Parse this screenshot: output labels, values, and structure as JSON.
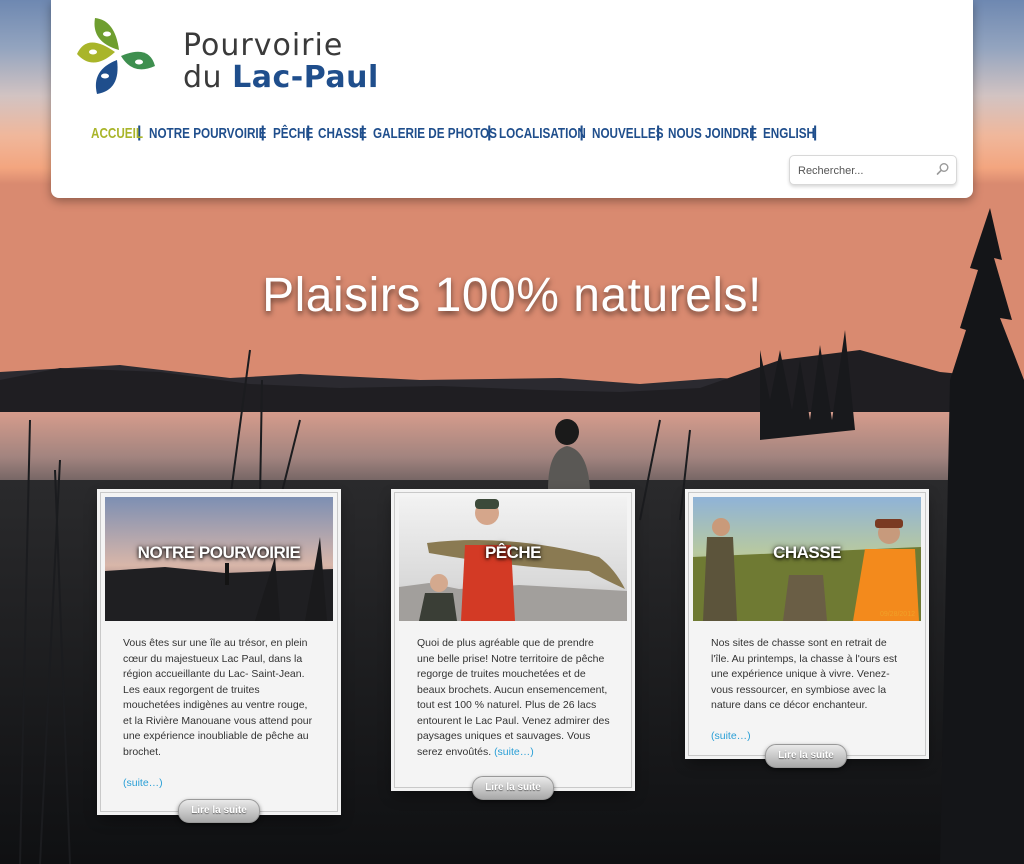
{
  "brand": {
    "line1": "Pourvoirie",
    "line2_prefix": "du ",
    "line2_bold": "Lac-Paul",
    "logo_colors": [
      "#a9b52a",
      "#6e9e2f",
      "#1f4e8c",
      "#3e8f4f"
    ]
  },
  "nav": {
    "items": [
      {
        "label": "ACCUEIL",
        "active": true
      },
      {
        "label": "NOTRE POURVOIRIE",
        "active": false
      },
      {
        "label": "PÊCHE",
        "active": false
      },
      {
        "label": "CHASSE",
        "active": false
      },
      {
        "label": "GALERIE DE PHOTOS",
        "active": false
      },
      {
        "label": "LOCALISATION",
        "active": false
      },
      {
        "label": "NOUVELLES",
        "active": false
      },
      {
        "label": "NOUS JOINDRE",
        "active": false
      },
      {
        "label": "ENGLISH",
        "active": false
      }
    ],
    "separator": "|",
    "accent_color": "#1f4e8c",
    "active_color": "#a9b52a"
  },
  "search": {
    "placeholder": "Rechercher...",
    "icon": "magnifier-icon"
  },
  "hero": {
    "headline": "Plaisirs 100% naturels!"
  },
  "cards": [
    {
      "title": "NOTRE POURVOIRIE",
      "text": "Vous êtes sur une île au trésor, en plein cœur du majestueux Lac Paul, dans la région accueillante du Lac- Saint-Jean. Les eaux regorgent de truites mouchetées indigènes au ventre rouge, et la Rivière Manouane vous attend pour une expérience inoubliable de pêche au brochet.",
      "link": "(suite…)",
      "button": "Lire la suite"
    },
    {
      "title": "PÊCHE",
      "text": "Quoi de plus agréable que de prendre une belle prise! Notre territoire de pêche regorge de truites mouchetées et de beaux brochets. Aucun ensemencement, tout est 100 % naturel. Plus de 26 lacs entourent le Lac Paul. Venez admirer des paysages uniques et sauvages. Vous serez envoûtés.",
      "link": "(suite…)",
      "button": "Lire la suite"
    },
    {
      "title": "CHASSE",
      "text": "Nos sites de chasse sont en retrait de l'île. Au printemps, la chasse à l'ours est une expérience unique à vivre. Venez-vous ressourcer, en symbiose avec la nature dans ce décor enchanteur.",
      "link": "(suite…)",
      "button": "Lire la suite",
      "photo_stamp": "09/28/2012"
    }
  ]
}
